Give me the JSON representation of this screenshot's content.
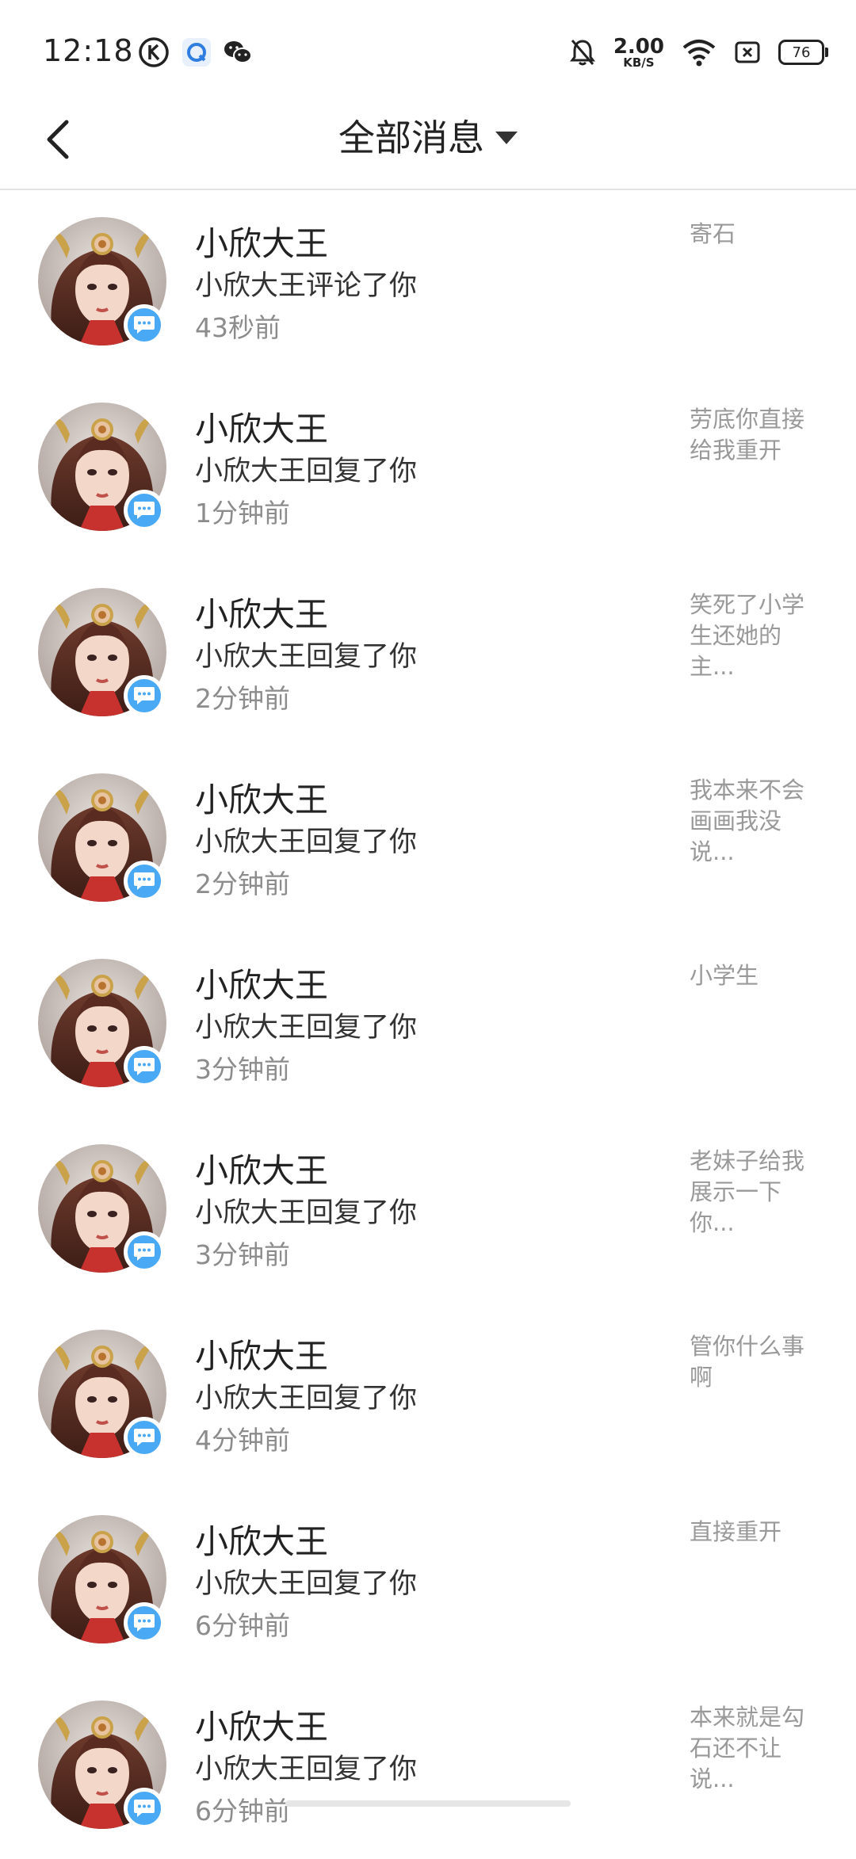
{
  "status_bar": {
    "time": "12:18",
    "net_speed_value": "2.00",
    "net_speed_unit": "KB/S",
    "battery_level": "76",
    "icons": [
      "k-app-icon",
      "browser-icon",
      "wechat-icon",
      "bell-off-icon",
      "wifi-icon",
      "sim-none-icon",
      "battery-icon"
    ]
  },
  "header": {
    "title": "全部消息",
    "icons": [
      "back-chevron-icon",
      "dropdown-caret-icon"
    ]
  },
  "messages": [
    {
      "name": "小欣大王",
      "action": "小欣大王评论了你",
      "time_ago": "43秒前",
      "snippet": "寄石"
    },
    {
      "name": "小欣大王",
      "action": "小欣大王回复了你",
      "time_ago": "1分钟前",
      "snippet": "劳底你直接给我重开"
    },
    {
      "name": "小欣大王",
      "action": "小欣大王回复了你",
      "time_ago": "2分钟前",
      "snippet": "笑死了小学生还她的主..."
    },
    {
      "name": "小欣大王",
      "action": "小欣大王回复了你",
      "time_ago": "2分钟前",
      "snippet": "我本来不会画画我没说..."
    },
    {
      "name": "小欣大王",
      "action": "小欣大王回复了你",
      "time_ago": "3分钟前",
      "snippet": "小学生"
    },
    {
      "name": "小欣大王",
      "action": "小欣大王回复了你",
      "time_ago": "3分钟前",
      "snippet": "老妹子给我展示一下你..."
    },
    {
      "name": "小欣大王",
      "action": "小欣大王回复了你",
      "time_ago": "4分钟前",
      "snippet": "管你什么事啊"
    },
    {
      "name": "小欣大王",
      "action": "小欣大王回复了你",
      "time_ago": "6分钟前",
      "snippet": "直接重开"
    },
    {
      "name": "小欣大王",
      "action": "小欣大王回复了你",
      "time_ago": "6分钟前",
      "snippet": "本来就是勾石还不让说..."
    }
  ],
  "colors": {
    "badge": "#4aa9f5",
    "secondary_text": "#8c8c8c",
    "snippet_text": "#999999"
  }
}
